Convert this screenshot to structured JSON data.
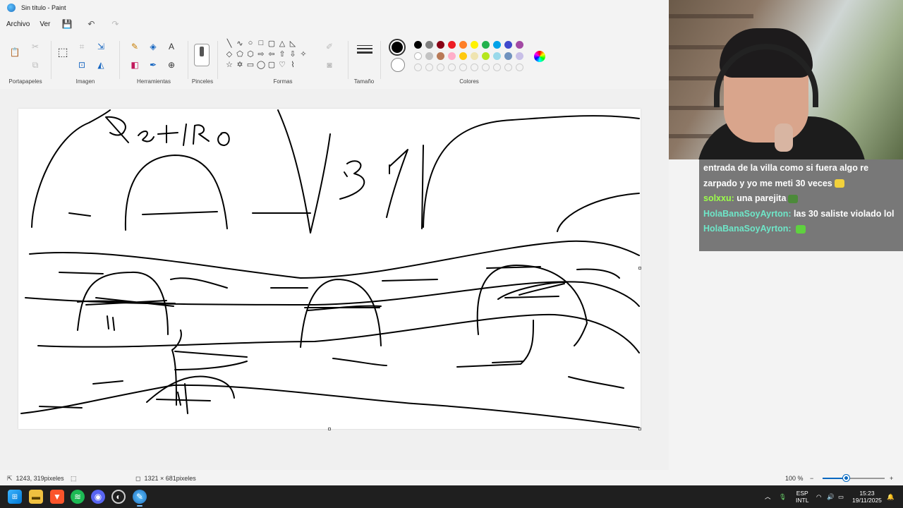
{
  "window": {
    "title": "Sin título - Paint"
  },
  "menu": {
    "file": "Archivo",
    "view": "Ver"
  },
  "ribbon": {
    "groups": {
      "clipboard": "Portapapeles",
      "image": "Imagen",
      "tools": "Herramientas",
      "brushes": "Pinceles",
      "shapes": "Formas",
      "size": "Tamaño",
      "colors": "Colores"
    },
    "shape_glyphs": [
      "╲",
      "∿",
      "○",
      "□",
      "▢",
      "△",
      "◺",
      "",
      "◇",
      "⬠",
      "⬡",
      "⇨",
      "⇦",
      "⇧",
      "⇩",
      "✧",
      "☆",
      "✡",
      "▭",
      "◯",
      "▢",
      "♡",
      "⌇",
      ""
    ],
    "active_color_1": "#000000",
    "active_color_2": "#ffffff",
    "palette_row1": [
      "#000000",
      "#7f7f7f",
      "#880015",
      "#ed1c24",
      "#ff7f27",
      "#fff200",
      "#22b14c",
      "#00a2e8",
      "#3f48cc",
      "#a349a4"
    ],
    "palette_row2": [
      "#ffffff",
      "#c3c3c3",
      "#b97a57",
      "#ffaec9",
      "#ffc90e",
      "#efe4b0",
      "#b5e61d",
      "#99d9ea",
      "#7092be",
      "#c8bfe7"
    ]
  },
  "canvas": {
    "handwriting": "Retiro",
    "bg": "#ffffff"
  },
  "statusbar": {
    "cursor_pos": "1243, 319pixeles",
    "canvas_size": "1321 × 681pixeles",
    "zoom": "100 %",
    "zoom_fraction": 0.39
  },
  "chat": {
    "lines": [
      {
        "user": "",
        "user_color": "#ffffff",
        "text": "entrada de la villa como si fuera algo re zarpado y yo me meti 30 veces",
        "emote": "#f2d13b"
      },
      {
        "user": "solxxu",
        "user_color": "#9cff4a",
        "text": "una parejita",
        "emote": "#4c8a3a"
      },
      {
        "user": "HolaBanaSoyAyrton",
        "user_color": "#6ee6c8",
        "text": "las 30 saliste violado lol",
        "emote": ""
      },
      {
        "user": "HolaBanaSoyAyrton",
        "user_color": "#6ee6c8",
        "text": "",
        "emote": "#5fd13f"
      }
    ]
  },
  "taskbar": {
    "lang_top": "ESP",
    "lang_bottom": "INTL",
    "time": "15:23",
    "date": "19/11/2025"
  }
}
